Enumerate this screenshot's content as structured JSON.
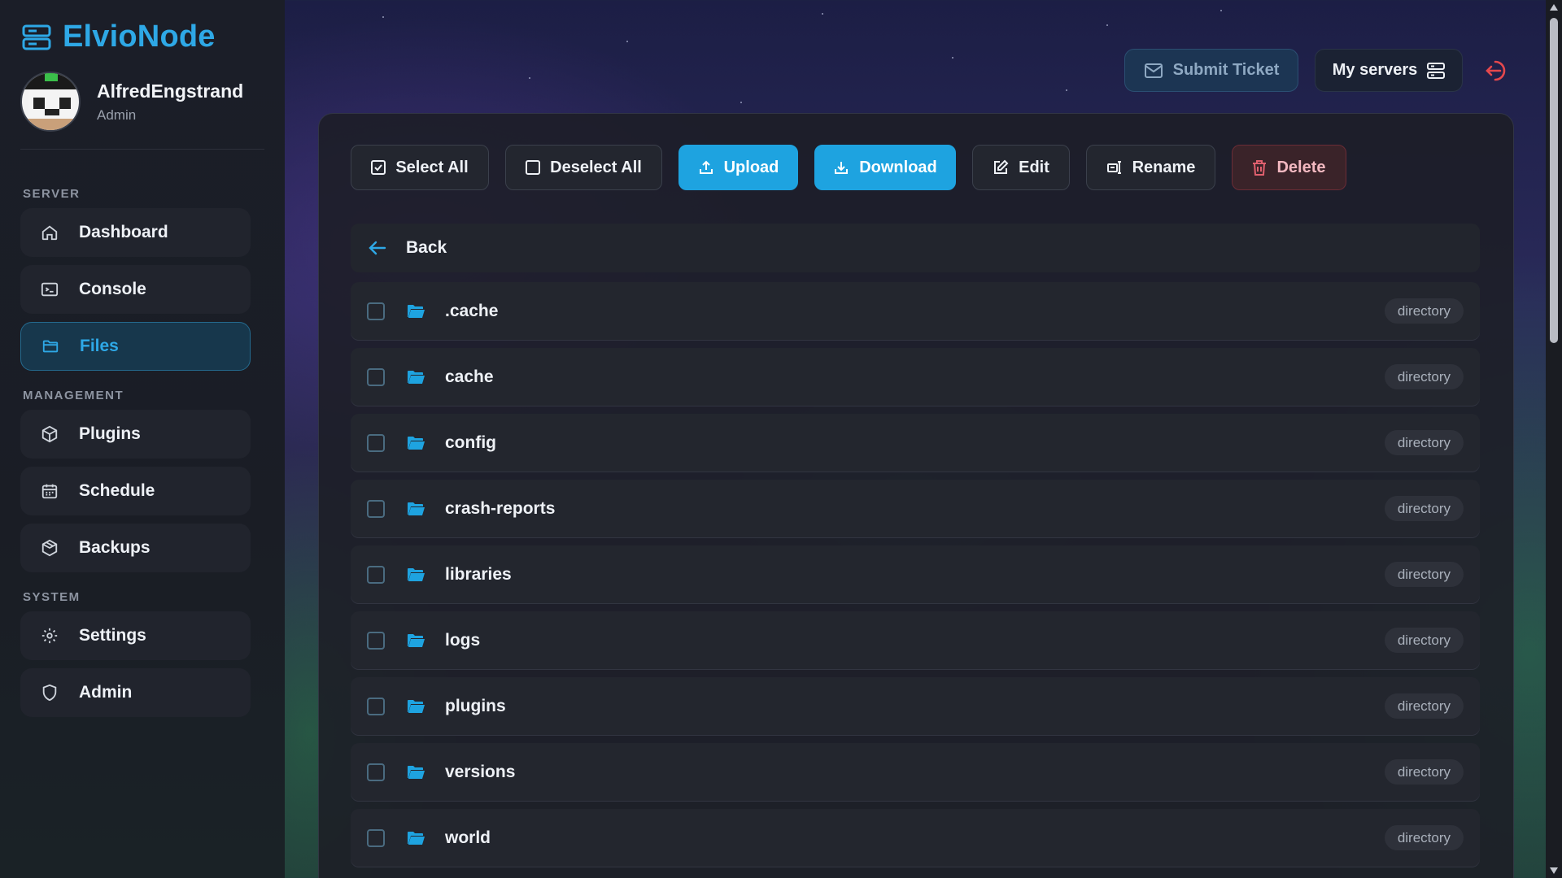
{
  "brand": {
    "name": "ElvioNode",
    "color": "#2ea8e6"
  },
  "user": {
    "name": "AlfredEngstrand",
    "role": "Admin"
  },
  "sidebar": {
    "sections": [
      {
        "label": "SERVER"
      },
      {
        "label": "MANAGEMENT"
      },
      {
        "label": "SYSTEM"
      }
    ],
    "items": [
      {
        "label": "Dashboard",
        "icon": "home-icon"
      },
      {
        "label": "Console",
        "icon": "terminal-icon"
      },
      {
        "label": "Files",
        "icon": "folder-icon",
        "active": true
      },
      {
        "label": "Plugins",
        "icon": "box-icon"
      },
      {
        "label": "Schedule",
        "icon": "calendar-icon"
      },
      {
        "label": "Backups",
        "icon": "archive-icon"
      },
      {
        "label": "Settings",
        "icon": "gear-icon"
      },
      {
        "label": "Admin",
        "icon": "shield-icon"
      }
    ]
  },
  "topbar": {
    "submit_ticket": "Submit Ticket",
    "my_servers": "My servers"
  },
  "toolbar": {
    "select_all": "Select All",
    "deselect_all": "Deselect All",
    "upload": "Upload",
    "download": "Download",
    "edit": "Edit",
    "rename": "Rename",
    "delete": "Delete"
  },
  "files": {
    "back_label": "Back",
    "rows": [
      {
        "name": ".cache",
        "type": "directory"
      },
      {
        "name": "cache",
        "type": "directory"
      },
      {
        "name": "config",
        "type": "directory"
      },
      {
        "name": "crash-reports",
        "type": "directory"
      },
      {
        "name": "libraries",
        "type": "directory"
      },
      {
        "name": "logs",
        "type": "directory"
      },
      {
        "name": "plugins",
        "type": "directory"
      },
      {
        "name": "versions",
        "type": "directory"
      },
      {
        "name": "world",
        "type": "directory"
      }
    ]
  },
  "colors": {
    "accent": "#1ea3e0",
    "danger": "#e0606e",
    "logout": "#e5484d"
  }
}
